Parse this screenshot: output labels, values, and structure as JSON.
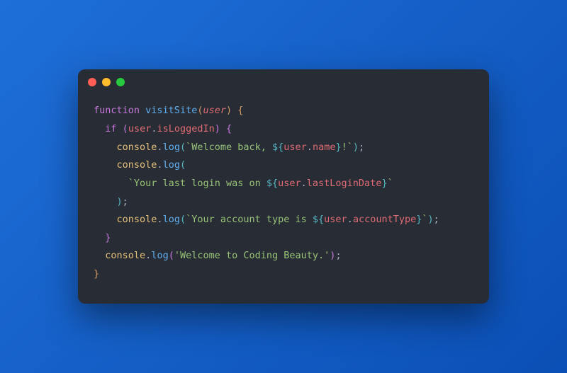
{
  "window": {
    "controls": {
      "close": "close",
      "minimize": "minimize",
      "zoom": "zoom"
    }
  },
  "code": {
    "lines": [
      [
        {
          "c": "tok-kw",
          "t": "function"
        },
        {
          "c": "",
          "t": " "
        },
        {
          "c": "tok-fn",
          "t": "visitSite"
        },
        {
          "c": "tok-brace",
          "t": "("
        },
        {
          "c": "tok-param",
          "t": "user"
        },
        {
          "c": "tok-brace",
          "t": ") {"
        }
      ],
      [
        {
          "c": "",
          "t": "  "
        },
        {
          "c": "tok-kw",
          "t": "if"
        },
        {
          "c": "",
          "t": " "
        },
        {
          "c": "tok-brace2",
          "t": "("
        },
        {
          "c": "tok-var",
          "t": "user"
        },
        {
          "c": "tok-punc",
          "t": "."
        },
        {
          "c": "tok-prop",
          "t": "isLoggedIn"
        },
        {
          "c": "tok-brace2",
          "t": ") {"
        }
      ],
      [
        {
          "c": "",
          "t": "    "
        },
        {
          "c": "tok-obj",
          "t": "console"
        },
        {
          "c": "tok-punc",
          "t": "."
        },
        {
          "c": "tok-fn",
          "t": "log"
        },
        {
          "c": "tok-brace3",
          "t": "("
        },
        {
          "c": "tok-str",
          "t": "`Welcome back, "
        },
        {
          "c": "tok-interp",
          "t": "${"
        },
        {
          "c": "tok-var",
          "t": "user"
        },
        {
          "c": "tok-punc",
          "t": "."
        },
        {
          "c": "tok-prop",
          "t": "name"
        },
        {
          "c": "tok-interp",
          "t": "}"
        },
        {
          "c": "tok-str",
          "t": "!`"
        },
        {
          "c": "tok-brace3",
          "t": ")"
        },
        {
          "c": "tok-punc",
          "t": ";"
        }
      ],
      [
        {
          "c": "",
          "t": "    "
        },
        {
          "c": "tok-obj",
          "t": "console"
        },
        {
          "c": "tok-punc",
          "t": "."
        },
        {
          "c": "tok-fn",
          "t": "log"
        },
        {
          "c": "tok-brace3",
          "t": "("
        }
      ],
      [
        {
          "c": "",
          "t": "      "
        },
        {
          "c": "tok-str",
          "t": "`Your last login was on "
        },
        {
          "c": "tok-interp",
          "t": "${"
        },
        {
          "c": "tok-var",
          "t": "user"
        },
        {
          "c": "tok-punc",
          "t": "."
        },
        {
          "c": "tok-prop",
          "t": "lastLoginDate"
        },
        {
          "c": "tok-interp",
          "t": "}"
        },
        {
          "c": "tok-str",
          "t": "`"
        }
      ],
      [
        {
          "c": "",
          "t": "    "
        },
        {
          "c": "tok-brace3",
          "t": ")"
        },
        {
          "c": "tok-punc",
          "t": ";"
        }
      ],
      [
        {
          "c": "",
          "t": "    "
        },
        {
          "c": "tok-obj",
          "t": "console"
        },
        {
          "c": "tok-punc",
          "t": "."
        },
        {
          "c": "tok-fn",
          "t": "log"
        },
        {
          "c": "tok-brace3",
          "t": "("
        },
        {
          "c": "tok-str",
          "t": "`Your account type is "
        },
        {
          "c": "tok-interp",
          "t": "${"
        },
        {
          "c": "tok-var",
          "t": "user"
        },
        {
          "c": "tok-punc",
          "t": "."
        },
        {
          "c": "tok-prop",
          "t": "accountType"
        },
        {
          "c": "tok-interp",
          "t": "}"
        },
        {
          "c": "tok-str",
          "t": "`"
        },
        {
          "c": "tok-brace3",
          "t": ")"
        },
        {
          "c": "tok-punc",
          "t": ";"
        }
      ],
      [
        {
          "c": "",
          "t": "  "
        },
        {
          "c": "tok-brace2",
          "t": "}"
        }
      ],
      [
        {
          "c": "",
          "t": "  "
        },
        {
          "c": "tok-obj",
          "t": "console"
        },
        {
          "c": "tok-punc",
          "t": "."
        },
        {
          "c": "tok-fn",
          "t": "log"
        },
        {
          "c": "tok-brace2",
          "t": "("
        },
        {
          "c": "tok-str",
          "t": "'Welcome to Coding Beauty.'"
        },
        {
          "c": "tok-brace2",
          "t": ")"
        },
        {
          "c": "tok-punc",
          "t": ";"
        }
      ],
      [
        {
          "c": "tok-brace",
          "t": "}"
        }
      ]
    ]
  }
}
